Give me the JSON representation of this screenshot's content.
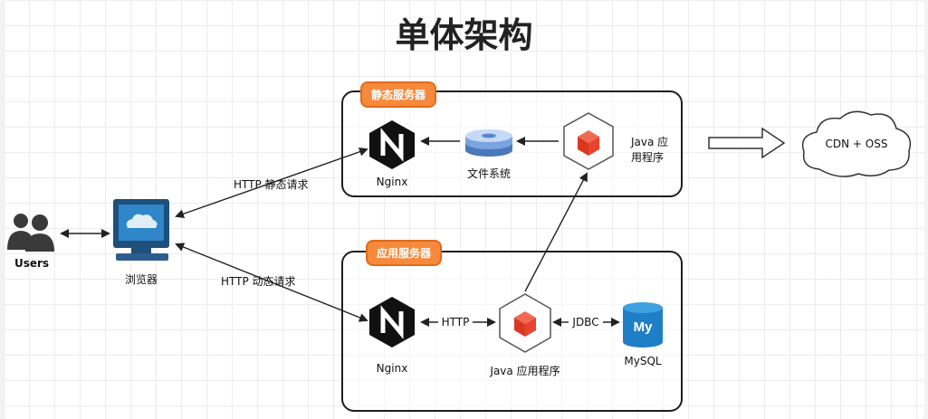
{
  "title": "单体架构",
  "static_server": {
    "tag": "静态服务器",
    "nginx_label": "Nginx",
    "fs_label": "文件系统",
    "java_label_line1": "Java 应",
    "java_label_line2": "用程序"
  },
  "app_server": {
    "tag": "应用服务器",
    "nginx_label": "Nginx",
    "java_label": "Java 应用程序",
    "mysql_label": "MySQL",
    "http_link": "HTTP",
    "jdbc_link": "JDBC"
  },
  "users_label": "Users",
  "browser_label": "浏览器",
  "http_static_request": "HTTP 静态请求",
  "http_dynamic_request": "HTTP 动态请求",
  "cdn_label": "CDN + OSS",
  "mysql_logo_text": "My",
  "colors": {
    "tag": "#f58a3c",
    "java_cube": "#e8432f",
    "mysql": "#1f7fc6",
    "nginx": "#111111"
  }
}
